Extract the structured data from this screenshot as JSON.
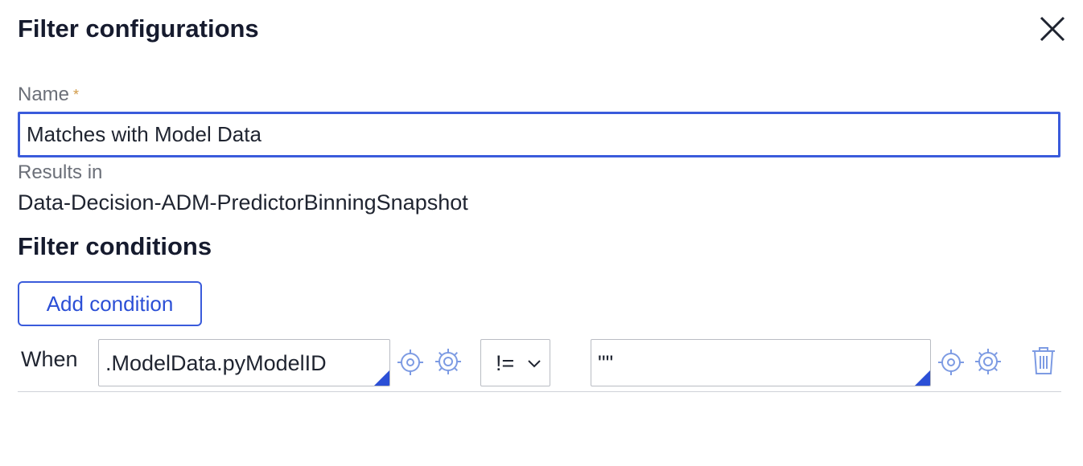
{
  "dialog": {
    "title": "Filter configurations"
  },
  "form": {
    "name_label": "Name",
    "required_mark": "*",
    "name_value": "Matches with Model Data",
    "results_label": "Results in",
    "results_value": "Data-Decision-ADM-PredictorBinningSnapshot"
  },
  "conditions": {
    "section_title": "Filter conditions",
    "add_button_label": "Add condition",
    "rows": [
      {
        "when_label": "When",
        "left_value": ".ModelData.pyModelID",
        "operator": "!=",
        "right_value": "\"\""
      }
    ]
  },
  "colors": {
    "accent": "#3a5bdb",
    "link_blue": "#2b4fd6",
    "icon_blue": "#7d9be3",
    "required": "#d19a47"
  },
  "icons": [
    "close-icon",
    "target-icon",
    "gear-icon",
    "chevron-down-icon",
    "trash-icon"
  ]
}
